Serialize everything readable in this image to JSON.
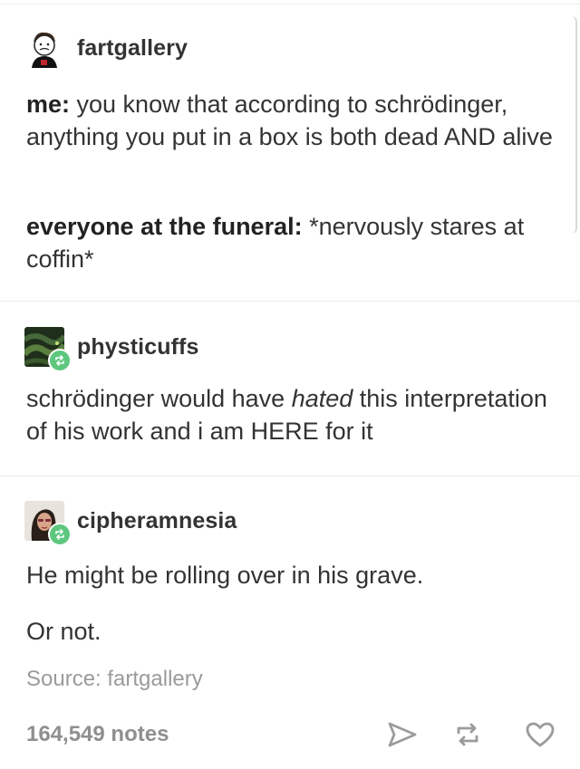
{
  "posts": [
    {
      "username": "fartgallery",
      "lines": [
        {
          "speaker": "me:",
          "text": " you know that according to schrödinger, anything you put in a box is both dead AND alive"
        },
        {
          "speaker": "everyone at the funeral:",
          "text": " *nervously stares at coffin*"
        }
      ]
    },
    {
      "username": "physticuffs",
      "text_before": "schrödinger would have ",
      "text_emphasis": "hated",
      "text_after": " this interpretation of his work and i am HERE for it"
    },
    {
      "username": "cipheramnesia",
      "paragraphs": [
        "He might be rolling over in his grave.",
        "Or not."
      ]
    }
  ],
  "source": "Source: fartgallery",
  "notes": "164,549 notes",
  "icons": {
    "share": "paper-plane-icon",
    "reblog": "reblog-icon",
    "like": "heart-icon",
    "badge": "reblog-badge-icon"
  },
  "colors": {
    "reblog_badge": "#5ec77e",
    "muted_text": "#9b9b9b",
    "main_text": "#333333"
  }
}
